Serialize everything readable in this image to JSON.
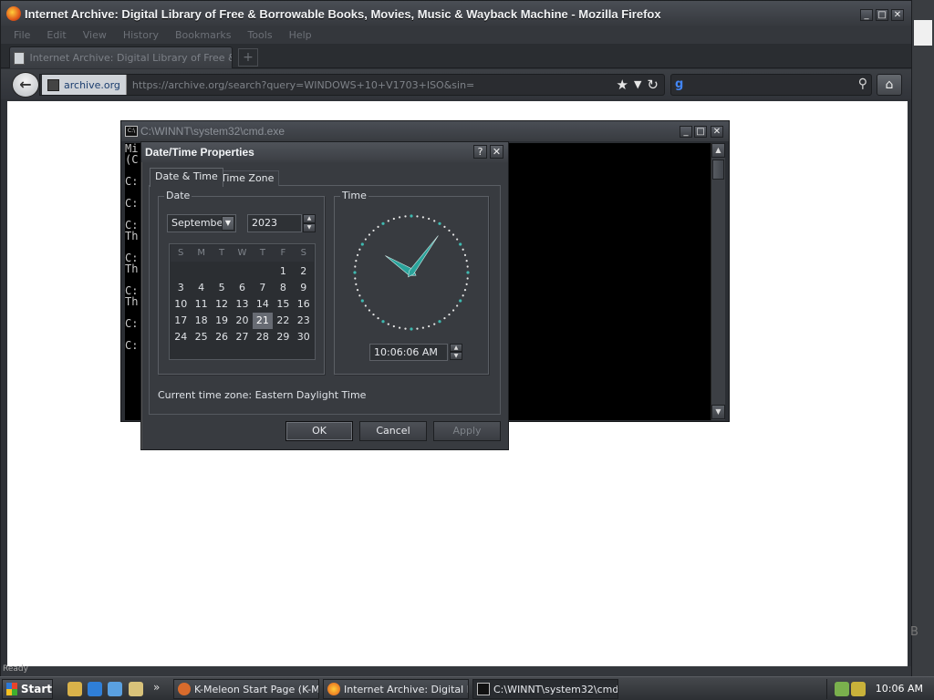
{
  "firefox": {
    "title": "Internet Archive: Digital Library of Free & Borrowable Books, Movies, Music & Wayback Machine - Mozilla Firefox",
    "menu": [
      "File",
      "Edit",
      "View",
      "History",
      "Bookmarks",
      "Tools",
      "Help"
    ],
    "tab_title": "Internet Archive: Digital Library of Free & Bo...",
    "new_tab": "+",
    "url_domain": "archive.org",
    "url": "https://archive.org/search?query=WINDOWS+10+V1703+ISO&sin=",
    "status": "Ready"
  },
  "cmd": {
    "title": "C:\\WINNT\\system32\\cmd.exe",
    "lines": [
      "Mi",
      "(C",
      "",
      "C:",
      "",
      "C:",
      "",
      "C:",
      "Th",
      "",
      "C:",
      "Th",
      "",
      "C:",
      "Th",
      "",
      "C:",
      "",
      "C:"
    ]
  },
  "dialog": {
    "title": "Date/Time Properties",
    "help": "?",
    "close": "✕",
    "tabs": [
      "Date & Time",
      "Time Zone"
    ],
    "date_group": "Date",
    "time_group": "Time",
    "month": "September",
    "year": "2023",
    "weekdays": [
      "S",
      "M",
      "T",
      "W",
      "T",
      "F",
      "S"
    ],
    "days": [
      "",
      "",
      "",
      "",
      "",
      "1",
      "2",
      "3",
      "4",
      "5",
      "6",
      "7",
      "8",
      "9",
      "10",
      "11",
      "12",
      "13",
      "14",
      "15",
      "16",
      "17",
      "18",
      "19",
      "20",
      "21",
      "22",
      "23",
      "24",
      "25",
      "26",
      "27",
      "28",
      "29",
      "30"
    ],
    "selected_day": "21",
    "time": "10:06:06 AM",
    "timezone_label": "Current time zone:",
    "timezone": "Eastern Daylight Time",
    "buttons": {
      "ok": "OK",
      "cancel": "Cancel",
      "apply": "Apply"
    }
  },
  "taskbar": {
    "start": "Start",
    "tasks": [
      "K-Meleon Start Page (K-M...",
      "Internet Archive: Digital L...",
      "C:\\WINNT\\system32\\cmd..."
    ],
    "clock": "10:06 AM"
  },
  "desktop": {
    "edge_letter": "B"
  },
  "icons": [
    "firefox-icon",
    "archive-icon",
    "back-arrow-icon",
    "star-icon",
    "reload-icon",
    "google-icon",
    "search-icon",
    "home-icon",
    "cmd-icon",
    "windows-flag-icon"
  ]
}
